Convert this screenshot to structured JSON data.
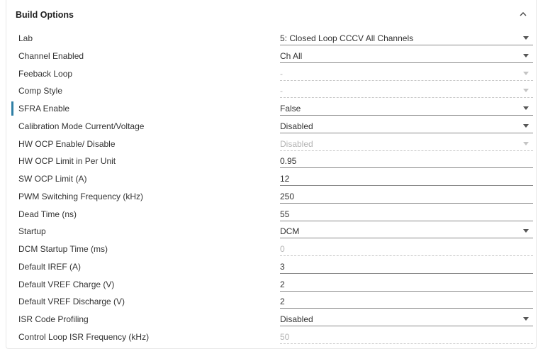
{
  "panel": {
    "title": "Build Options",
    "collapse_icon": "chevron-up-icon"
  },
  "rows": [
    {
      "label": "Lab",
      "value": "5: Closed Loop CCCV All Channels",
      "type": "select",
      "disabled": false
    },
    {
      "label": "Channel Enabled",
      "value": "Ch All",
      "type": "select",
      "disabled": false
    },
    {
      "label": "Feeback Loop",
      "value": "-",
      "type": "select",
      "disabled": true
    },
    {
      "label": "Comp Style",
      "value": "-",
      "type": "select",
      "disabled": true
    },
    {
      "label": "SFRA Enable",
      "value": "False",
      "type": "select",
      "disabled": false,
      "highlighted": true
    },
    {
      "label": "Calibration Mode Current/Voltage",
      "value": "Disabled",
      "type": "select",
      "disabled": false
    },
    {
      "label": "HW OCP Enable/ Disable",
      "value": "Disabled",
      "type": "select",
      "disabled": true
    },
    {
      "label": "HW OCP Limit in Per Unit",
      "value": "0.95",
      "type": "input",
      "disabled": false
    },
    {
      "label": "SW OCP Limit (A)",
      "value": "12",
      "type": "input",
      "disabled": false
    },
    {
      "label": "PWM Switching Frequency (kHz)",
      "value": "250",
      "type": "input",
      "disabled": false
    },
    {
      "label": "Dead Time (ns)",
      "value": "55",
      "type": "input",
      "disabled": false
    },
    {
      "label": "Startup",
      "value": "DCM",
      "type": "select",
      "disabled": false
    },
    {
      "label": "DCM Startup Time (ms)",
      "value": "0",
      "type": "input",
      "disabled": true
    },
    {
      "label": "Default IREF (A)",
      "value": "3",
      "type": "input",
      "disabled": false
    },
    {
      "label": "Default VREF Charge (V)",
      "value": "2",
      "type": "input",
      "disabled": false
    },
    {
      "label": "Default VREF Discharge (V)",
      "value": "2",
      "type": "input",
      "disabled": false
    },
    {
      "label": "ISR Code Profiling",
      "value": "Disabled",
      "type": "select",
      "disabled": false
    },
    {
      "label": "Control Loop ISR Frequency (kHz)",
      "value": "50",
      "type": "input",
      "disabled": true
    }
  ],
  "colors": {
    "highlight_indicator": "#2f7fa5",
    "text": "#333333",
    "disabled_text": "#b3b3b3"
  }
}
